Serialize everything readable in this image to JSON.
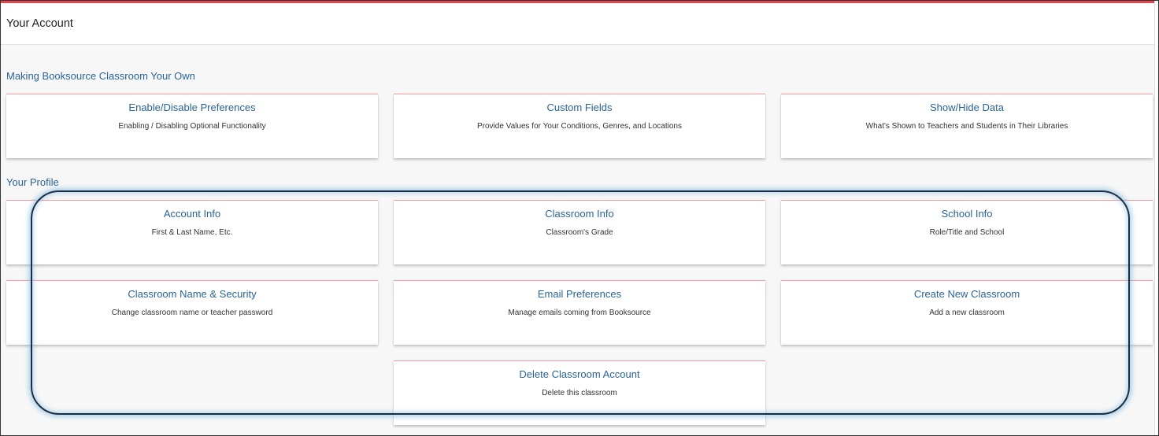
{
  "header": {
    "title": "Your Account"
  },
  "sections": [
    {
      "title": "Making Booksource Classroom Your Own",
      "cards": [
        {
          "title": "Enable/Disable Preferences",
          "desc": "Enabling / Disabling Optional Functionality"
        },
        {
          "title": "Custom Fields",
          "desc": "Provide Values for Your Conditions, Genres, and Locations"
        },
        {
          "title": "Show/Hide Data",
          "desc": "What's Shown to Teachers and Students in Their Libraries"
        }
      ]
    },
    {
      "title": "Your Profile",
      "cards": [
        {
          "title": "Account Info",
          "desc": "First & Last Name, Etc."
        },
        {
          "title": "Classroom Info",
          "desc": "Classroom's Grade"
        },
        {
          "title": "School Info",
          "desc": "Role/Title and School"
        },
        {
          "title": "Classroom Name & Security",
          "desc": "Change classroom name or teacher password"
        },
        {
          "title": "Email Preferences",
          "desc": "Manage emails coming from Booksource"
        },
        {
          "title": "Create New Classroom",
          "desc": "Add a new classroom"
        },
        {
          "title": "Delete Classroom Account",
          "desc": "Delete this classroom"
        }
      ]
    }
  ],
  "colors": {
    "accent_red": "#e4464d",
    "link_blue": "#2a6496",
    "highlight_ring": "#1b2e47"
  }
}
